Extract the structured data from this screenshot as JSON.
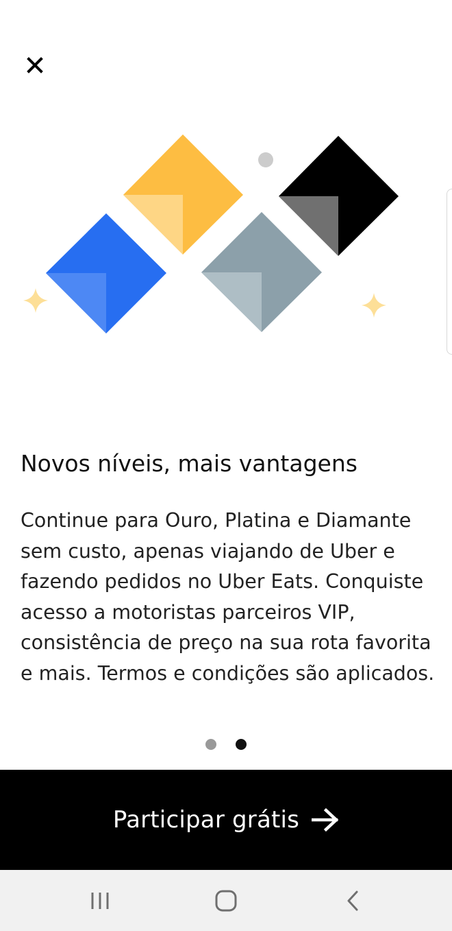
{
  "onboarding": {
    "title": "Novos níveis, mais vantagens",
    "body": "Continue para Ouro, Platina e Diamante sem custo, apenas viajando de Uber e fazendo pedidos no Uber Eats. Conquiste acesso a motoristas parceiros VIP, consistência de preço na sua rota favorita e mais. Termos e condições são aplicados.",
    "pager": {
      "total": 2,
      "active_index": 1
    },
    "cta_label": "Participar grátis"
  },
  "icons": {
    "close": "close-icon",
    "cta_arrow": "arrow-right-icon",
    "nav_recents": "recent-apps-icon",
    "nav_home": "home-icon",
    "nav_back": "back-icon"
  },
  "colors": {
    "gold": "#FDBD42",
    "gold_fold": "#FED685",
    "blue": "#276EF1",
    "blue_fold": "#4D88F4",
    "platinum": "#8CA0AA",
    "platinum_fold": "#AEBEC5",
    "diamond": "#000000",
    "diamond_fold": "#707070",
    "sparkle": "#FDDF97",
    "dot_grey": "#CCCCCC",
    "pager_active": "#111111",
    "pager_inactive": "#999999",
    "cta_background": "#000000",
    "navbar_background": "#F1F1F1"
  }
}
